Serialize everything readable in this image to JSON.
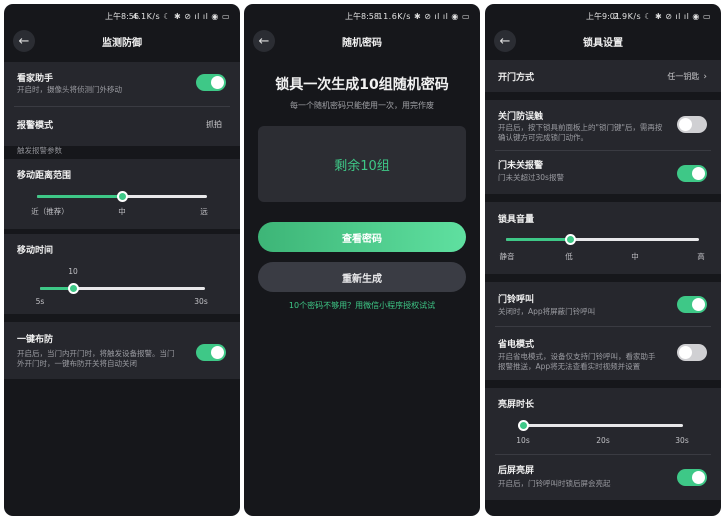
{
  "screen1": {
    "status": {
      "time": "上午8:56",
      "right": "4.1K/s ☾ ✱ ⊘ ıl ıl ◉ ▭"
    },
    "title": "监测防御",
    "home_assist": {
      "label": "看家助手",
      "desc": "开启时，摄像头将侦测门外移动",
      "on": true
    },
    "alarm_mode": {
      "label": "报警模式",
      "value": "抓拍"
    },
    "trigger_section": "触发报警参数",
    "distance": {
      "label": "移动距离范围",
      "ticks": [
        "近（推荐）",
        "中",
        "远"
      ],
      "level": 0.5
    },
    "duration": {
      "label": "移动时间",
      "min": "5s",
      "max": "30s",
      "current": "10",
      "level": 0.2
    },
    "arm": {
      "label": "一键布防",
      "desc1": "开启后，当门内开门时，将触发设备报警。当门",
      "desc2": "外开门时，一键布防开关将自动关闭",
      "on": true
    }
  },
  "screen2": {
    "status": {
      "time": "上午8:58",
      "right": "11.6K/s ✱ ⊘ ıl ıl ◉ ▭"
    },
    "title": "随机密码",
    "heading": "锁具一次生成10组随机密码",
    "subheading": "每一个随机密码只能使用一次，用完作废",
    "remaining": "剩余10组",
    "view_button": "查看密码",
    "regen_button": "重新生成",
    "hint_link": "10个密码不够用？用微信小程序授权试试"
  },
  "screen3": {
    "status": {
      "time": "上午9:01",
      "right": "2.9K/s ☾ ✱ ⊘ ıl ıl ◉ ▭"
    },
    "title": "锁具设置",
    "open_mode": {
      "label": "开门方式",
      "value": "任一钥匙"
    },
    "anti_mistouch": {
      "label": "关门防误触",
      "desc1": "开启后，按下锁具前面板上的\"锁门键\"后，需再按",
      "desc2": "确认键方可完成锁门动作。",
      "on": false
    },
    "door_alarm": {
      "label": "门未关报警",
      "desc": "门未关超过30s报警",
      "on": true
    },
    "volume": {
      "label": "锁具音量",
      "ticks": [
        "静音",
        "低",
        "中",
        "高"
      ],
      "level": 0.333
    },
    "doorbell": {
      "label": "门铃呼叫",
      "desc": "关闭时，App将屏蔽门铃呼叫",
      "on": true
    },
    "power_save": {
      "label": "省电模式",
      "desc1": "开启省电模式，设备仅支持门铃呼叫，看家助手",
      "desc2": "报警推送，App将无法查看实时视频并设置",
      "on": false
    },
    "screen_time": {
      "label": "亮屏时长",
      "ticks": [
        "10s",
        "20s",
        "30s"
      ],
      "level": 0
    },
    "rear_screen": {
      "label": "后屏亮屏",
      "desc": "开启后，门铃呼叫时锁后屏会亮起",
      "on": true
    }
  }
}
